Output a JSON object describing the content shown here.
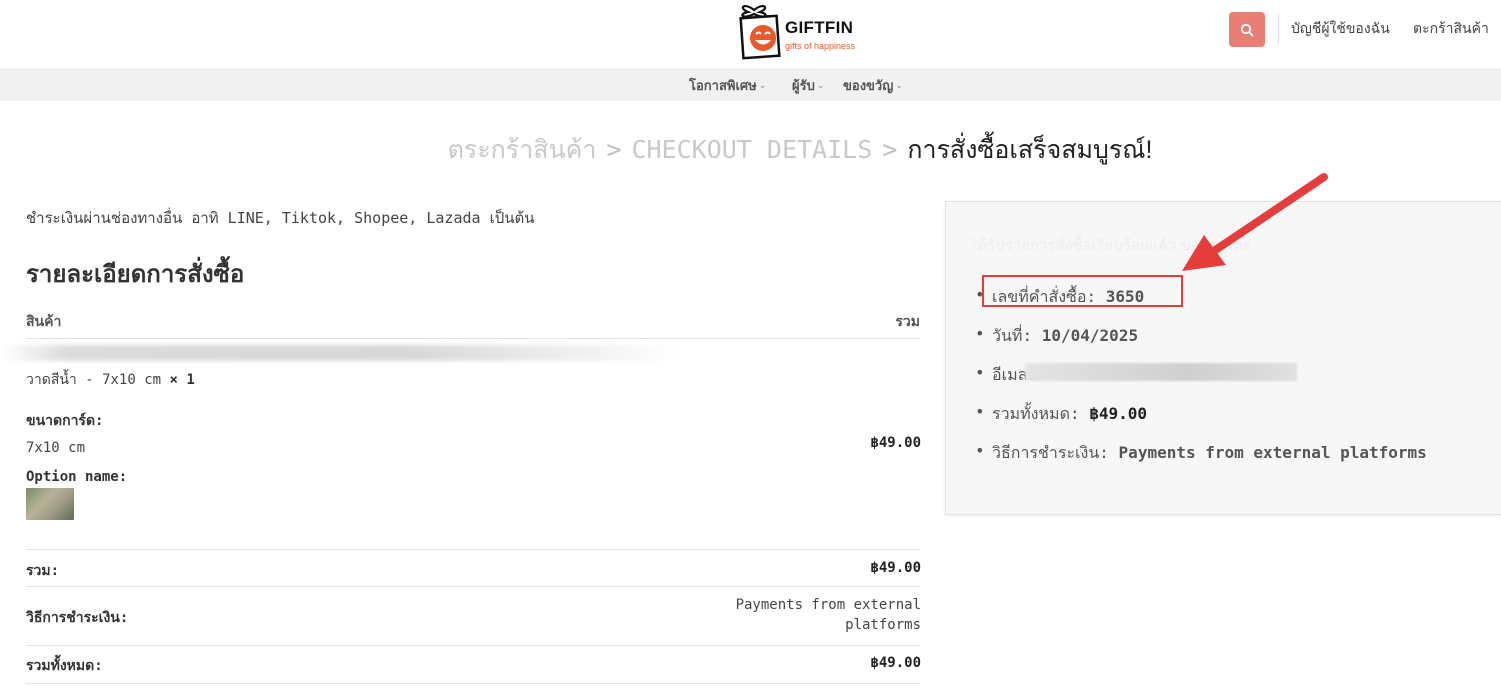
{
  "brand": {
    "name": "GIFTFIN",
    "tagline": "gifts of happiness"
  },
  "header": {
    "account_link": "บัญชีผู้ใช้ของฉัน",
    "cart_link": "ตะกร้าสินค้า",
    "search_icon": "search-icon"
  },
  "nav": [
    {
      "label": "โอกาสพิเศษ"
    },
    {
      "label": "ผู้รับ"
    },
    {
      "label": "ของขวัญ"
    }
  ],
  "breadcrumb": {
    "step1": "ตระกร้าสินค้า",
    "step2": "CHECKOUT DETAILS",
    "step3": "การสั่งซื้อเสร็จสมบูรณ์!",
    "separator": ">"
  },
  "payment_note": "ชำระเงินผ่านช่องทางอื่น อาทิ LINE, Tiktok, Shopee, Lazada เป็นต้น",
  "order_details": {
    "heading": "รายละเอียดการสั่งซื้อ",
    "col_product": "สินค้า",
    "col_total": "รวม",
    "item": {
      "name_line2": "วาดสีน้ำ - 7x10 cm",
      "qty": "× 1",
      "size_label": "ขนาดการ์ด:",
      "size_value": "7x10 cm",
      "option_label": "Option name:",
      "price": "฿49.00"
    },
    "subtotal_label": "รวม:",
    "subtotal_value": "฿49.00",
    "payment_label": "วิธีการชำระเงิน:",
    "payment_value_line1": "Payments from external",
    "payment_value_line2": "platforms",
    "total_label": "รวมทั้งหมด:",
    "total_value": "฿49.00"
  },
  "summary": {
    "thanks_message": "ได้รับรายการสั่งซื้อเรียบร้อยแล้ว ขอบคุณค่ะ",
    "order_number_label": "เลขที่คำสั่งซื้อ:",
    "order_number": "3650",
    "date_label": "วันที่:",
    "date": "10/04/2025",
    "email_label": "อีเมล:",
    "total_label": "รวมทั้งหมด:",
    "total": "฿49.00",
    "payment_label": "วิธีการชำระเงิน:",
    "payment_method": "Payments from external platforms"
  },
  "colors": {
    "accent": "#e97f74",
    "highlight": "#e53c3c"
  }
}
